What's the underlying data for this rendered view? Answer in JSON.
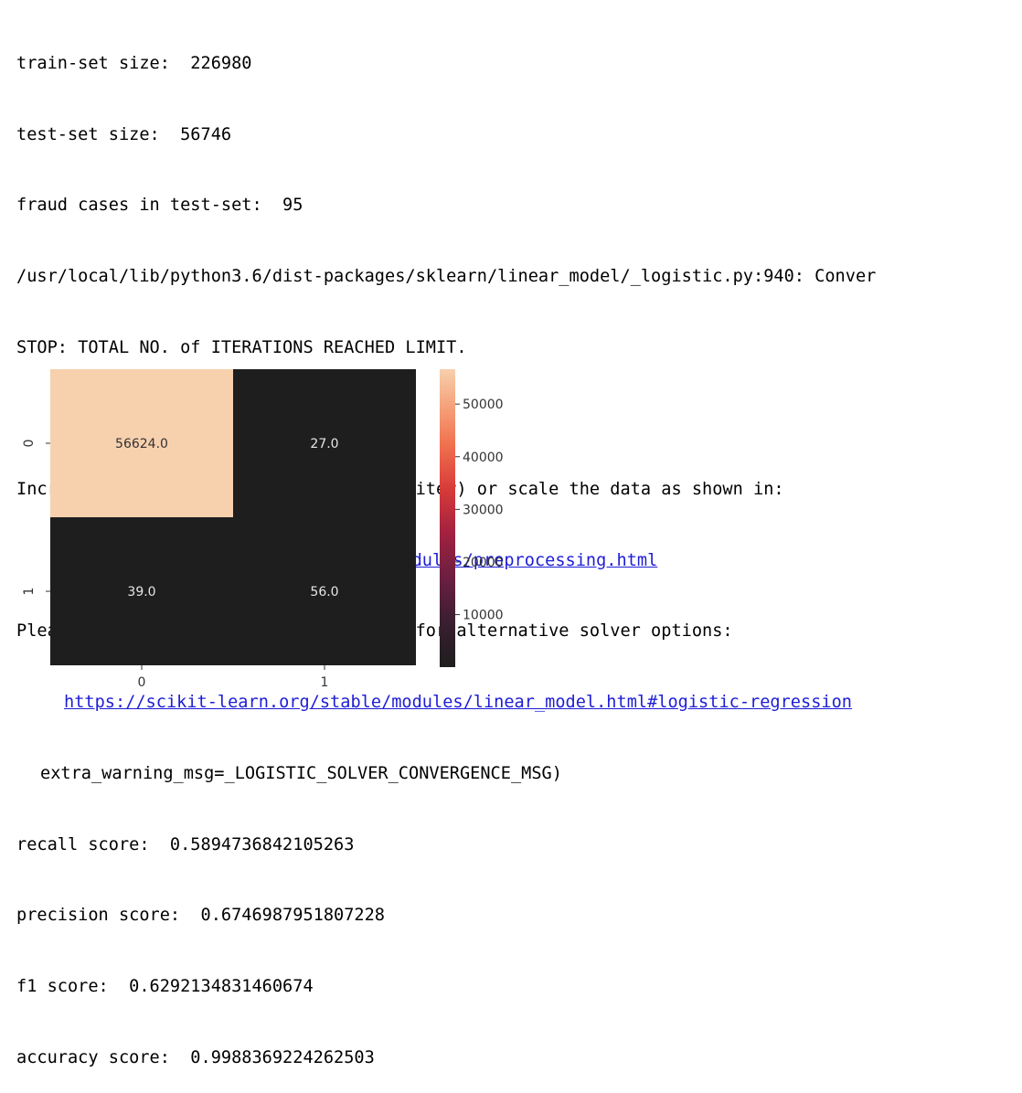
{
  "output": {
    "lines": {
      "train_size": "train-set size:  226980",
      "test_size": "test-set size:  56746",
      "fraud_cases": "fraud cases in test-set:  95",
      "warning_path": "/usr/local/lib/python3.6/dist-packages/sklearn/linear_model/_logistic.py:940: Conver",
      "stop_msg": "STOP: TOTAL NO. of ITERATIONS REACHED LIMIT.",
      "increase_msg": "Increase the number of iterations (max_iter) or scale the data as shown in:",
      "link_preprocessing": "https://scikit-learn.org/stable/modules/preprocessing.html",
      "refer_msg": "Please also refer to the documentation for alternative solver options:",
      "link_logistic": "https://scikit-learn.org/stable/modules/linear_model.html#logistic-regression",
      "extra_warning": "extra_warning_msg=_LOGISTIC_SOLVER_CONVERGENCE_MSG)",
      "recall": "recall score:  0.5894736842105263",
      "precision": "precision score:  0.6746987951807228",
      "f1": "f1 score:  0.6292134831460674",
      "accuracy": "accuracy score:  0.9988369224262503"
    },
    "link_color": "#1d1dd6"
  },
  "chart_data": {
    "type": "heatmap",
    "title": "",
    "xlabel": "",
    "ylabel": "",
    "x_categories": [
      "0",
      "1"
    ],
    "y_categories": [
      "0",
      "1"
    ],
    "values": [
      [
        56624.0,
        27.0
      ],
      [
        39.0,
        56.0
      ]
    ],
    "annotations": [
      [
        "56624.0",
        "27.0"
      ],
      [
        "39.0",
        "56.0"
      ]
    ],
    "colormap": "rocket",
    "vmin": 27.0,
    "vmax": 56624.0,
    "colorbar_ticks": [
      10000,
      20000,
      30000,
      40000,
      50000
    ],
    "colorbar_tick_labels": [
      "10000",
      "20000",
      "30000",
      "40000",
      "50000"
    ],
    "colors": {
      "low": "#1e1e1e",
      "high": "#f7d0ad",
      "annotation_on_dark": "#e6e6e6",
      "annotation_on_light": "#333333"
    }
  }
}
